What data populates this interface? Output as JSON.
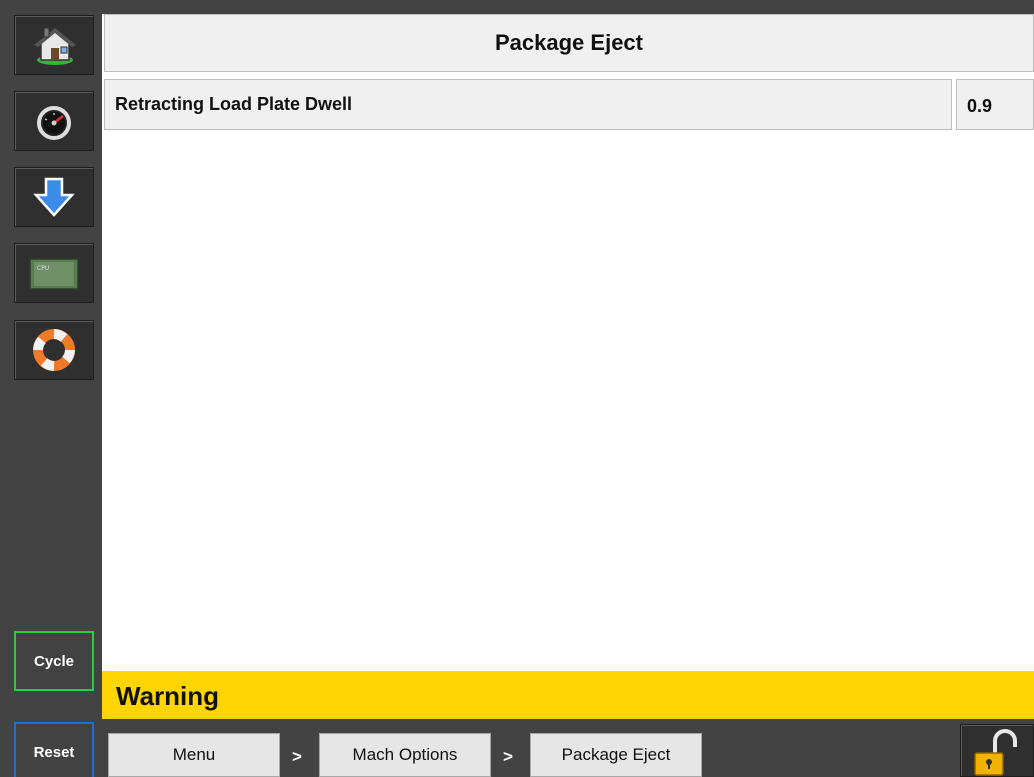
{
  "header": {
    "title": "Package Eject"
  },
  "sidebar": {
    "icons": [
      {
        "name": "home-icon"
      },
      {
        "name": "gauge-icon"
      },
      {
        "name": "download-arrow-icon"
      },
      {
        "name": "cpu-chip-icon"
      },
      {
        "name": "help-lifebuoy-icon"
      }
    ],
    "cycle_label": "Cycle",
    "reset_label": "Reset"
  },
  "parameter": {
    "label": "Retracting Load Plate Dwell",
    "value": "0.9"
  },
  "warning": {
    "text": "Warning"
  },
  "breadcrumb": {
    "items": [
      "Menu",
      "Mach Options",
      "Package Eject"
    ],
    "separator": ">"
  },
  "lock": {
    "icon": "unlocked-padlock-icon"
  },
  "colors": {
    "sidebar_bg": "#434343",
    "warning_bg": "#ffd500",
    "cycle_border": "#2ecc40",
    "reset_border": "#1e6fd0"
  }
}
